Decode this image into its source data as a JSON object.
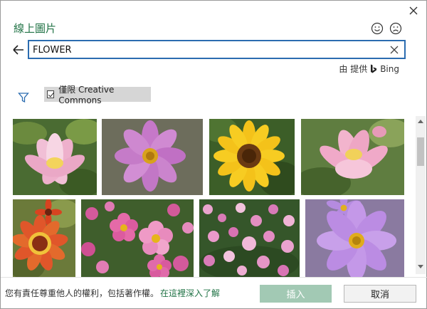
{
  "dialog": {
    "title": "線上圖片",
    "close_icon": "close-icon",
    "feedback": [
      "smile-icon",
      "frown-icon"
    ]
  },
  "search": {
    "value": "FLOWER",
    "back_icon": "arrow-left-icon",
    "clear_icon": "close-icon"
  },
  "provider": {
    "prefix": "由 提供",
    "brand": "Bing",
    "brand_icon": "bing-logo-icon"
  },
  "filter": {
    "icon": "filter-icon",
    "cc_label": "僅限 Creative Commons",
    "cc_checked": true
  },
  "results": {
    "count_visible": 8,
    "subjects": [
      "lotus",
      "cosmos",
      "sunflower",
      "lotus",
      "gaillardia",
      "cosmos-field",
      "cosmos-field",
      "cosmos"
    ]
  },
  "footer": {
    "notice": "您有責任尊重他人的權利，包括著作權。",
    "link": "在這裡深入了解",
    "insert_label": "插入",
    "cancel_label": "取消"
  },
  "colors": {
    "accent": "#217346",
    "focus": "#2b6cb0",
    "insert_disabled": "#a2c9b4"
  }
}
